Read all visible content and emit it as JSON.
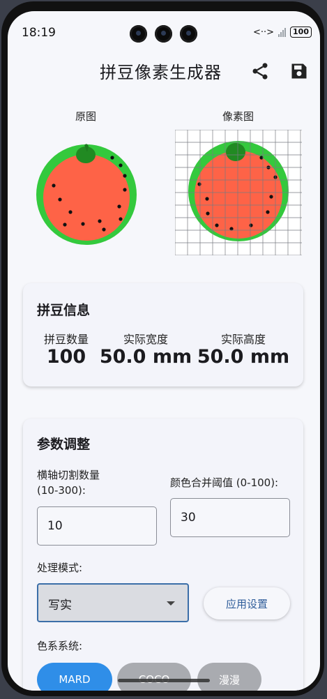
{
  "status_bar": {
    "time": "18:19",
    "battery": "100",
    "link_icon": "<··>",
    "mute_mark": "×"
  },
  "app_bar": {
    "title": "拼豆像素生成器",
    "actions": [
      "share-icon",
      "save-icon"
    ]
  },
  "preview": {
    "original_label": "原图",
    "pixel_label": "像素图"
  },
  "bead_info": {
    "title": "拼豆信息",
    "stats": [
      {
        "label": "拼豆数量",
        "value": "100"
      },
      {
        "label": "实际宽度",
        "value": "50.0 mm"
      },
      {
        "label": "实际高度",
        "value": "50.0 mm"
      }
    ]
  },
  "params": {
    "title": "参数调整",
    "cut_count": {
      "label": "横轴切割数量\n(10-300):",
      "value": "10"
    },
    "merge_threshold": {
      "label": "颜色合并阈值 (0-100):",
      "value": "30"
    },
    "mode": {
      "label": "处理模式:",
      "value": "写实"
    },
    "apply_label": "应用设置",
    "palette": {
      "label": "色系系统:",
      "options": [
        {
          "label": "MARD",
          "selected": true
        },
        {
          "label": "COCO",
          "selected": false
        },
        {
          "label": "漫漫",
          "selected": false
        }
      ]
    }
  },
  "colors": {
    "accent": "#2f8ee8",
    "melon_red": "#fe6347",
    "rind_green": "#34c93d",
    "stem_green": "#218a22"
  }
}
